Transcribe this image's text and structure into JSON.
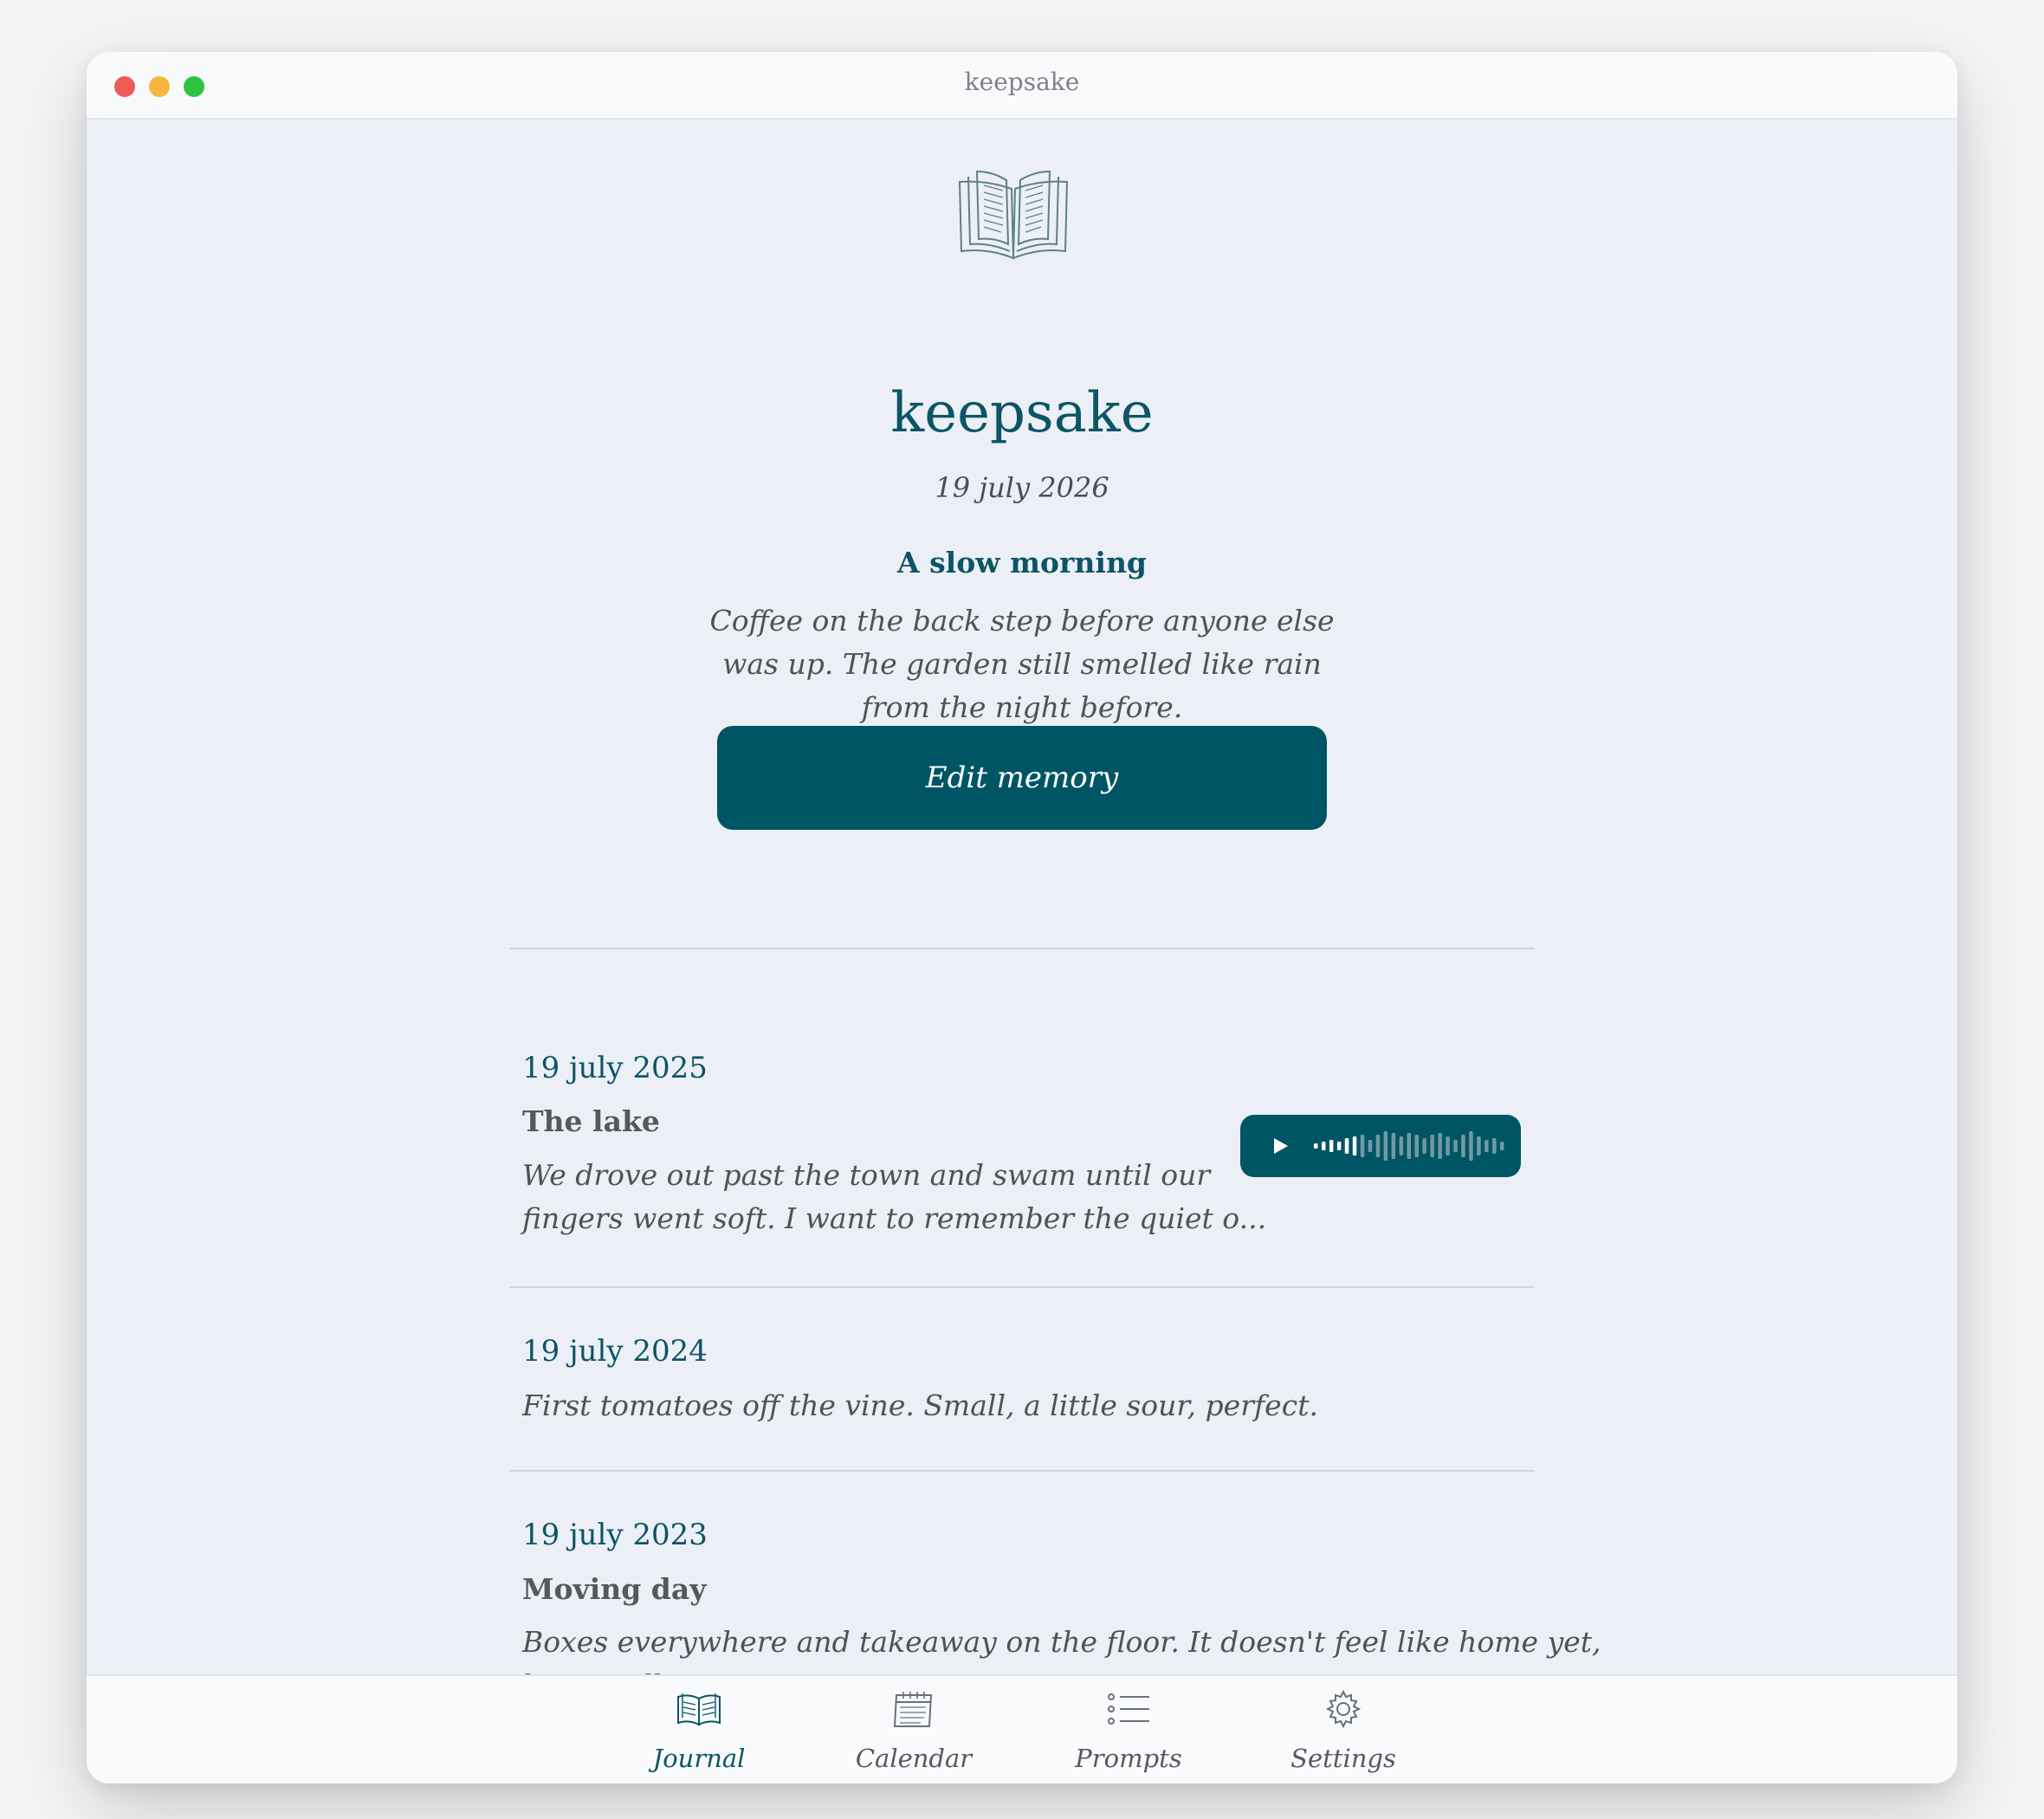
{
  "window": {
    "title": "keepsake"
  },
  "header": {
    "app_name": "keepsake",
    "date": "19 july 2026",
    "memory_title": "A slow morning",
    "memory_text": "Coffee on the back step before anyone else was up. The garden still smelled like rain from the night before.",
    "edit_label": "Edit memory",
    "icon": "open-book-icon"
  },
  "entries": [
    {
      "date": "19 july 2025",
      "title": "The lake",
      "text_line1": "We drove out past the town and swam until our",
      "text_line2": "fingers went soft. I want to remember the quiet o...",
      "has_audio": true,
      "audio_progress": 0.22
    },
    {
      "date": "19 july 2024",
      "text_line1": "First tomatoes off the vine. Small, a little sour, perfect."
    },
    {
      "date": "19 july 2023",
      "title": "Moving day",
      "text_line1": "Boxes everywhere and takeaway on the floor. It doesn't feel like home yet,",
      "text_line2": "but it will."
    }
  ],
  "tabs": [
    {
      "label": "Journal",
      "icon": "book-icon",
      "active": true
    },
    {
      "label": "Calendar",
      "icon": "calendar-icon",
      "active": false
    },
    {
      "label": "Prompts",
      "icon": "list-icon",
      "active": false
    },
    {
      "label": "Settings",
      "icon": "gear-icon",
      "active": false
    }
  ],
  "colors": {
    "accent": "#005565",
    "background": "#eceff5",
    "text": "#4f5358"
  }
}
